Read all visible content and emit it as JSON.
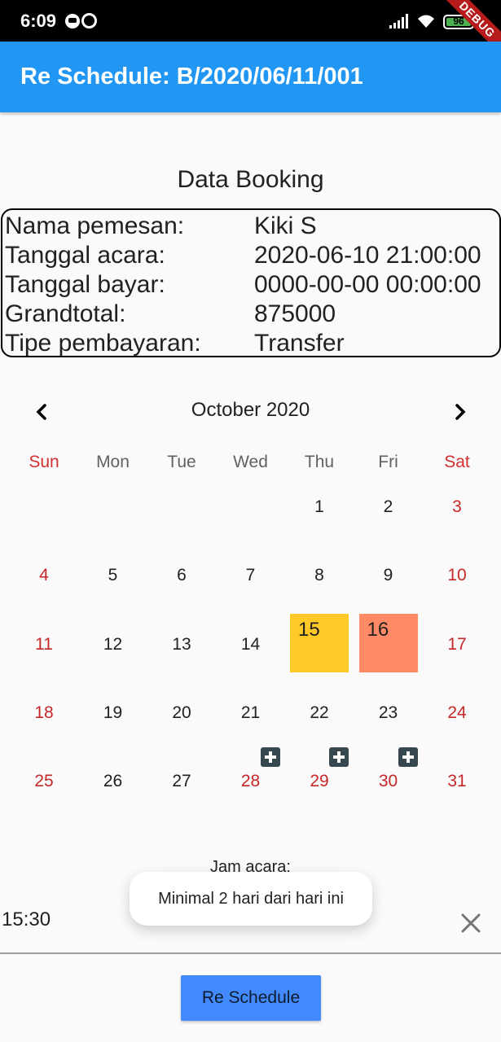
{
  "status_bar": {
    "time": "6:09",
    "battery": "96",
    "debug_label": "DEBUG",
    "icons": [
      "line-app-icon",
      "navigation-icon",
      "signal-icon",
      "wifi-icon",
      "battery-icon"
    ]
  },
  "app_bar": {
    "title": "Re Schedule: B/2020/06/11/001"
  },
  "booking": {
    "section_title": "Data Booking",
    "rows": [
      {
        "label": "Nama pemesan:",
        "value": "Kiki S"
      },
      {
        "label": "Tanggal acara:",
        "value": "2020-06-10 21:00:00"
      },
      {
        "label": "Tanggal bayar:",
        "value": "0000-00-00 00:00:00"
      },
      {
        "label": "Grandtotal:",
        "value": "875000"
      },
      {
        "label": "Tipe pembayaran:",
        "value": "Transfer"
      }
    ]
  },
  "calendar": {
    "month": "October 2020",
    "weekdays": [
      "Sun",
      "Mon",
      "Tue",
      "Wed",
      "Thu",
      "Fri",
      "Sat"
    ],
    "weeks": [
      [
        "",
        "",
        "",
        "",
        "1",
        "2",
        "3"
      ],
      [
        "4",
        "5",
        "6",
        "7",
        "8",
        "9",
        "10"
      ],
      [
        "11",
        "12",
        "13",
        "14",
        "15",
        "16",
        "17"
      ],
      [
        "18",
        "19",
        "20",
        "21",
        "22",
        "23",
        "24"
      ],
      [
        "25",
        "26",
        "27",
        "28",
        "29",
        "30",
        "31"
      ]
    ],
    "highlighted": [
      {
        "day": "15",
        "color": "#ffca28"
      },
      {
        "day": "16",
        "color": "#ff8a65"
      }
    ],
    "red_days": [
      "28",
      "29",
      "30"
    ],
    "add_markers": [
      "28",
      "29",
      "30"
    ],
    "colors": {
      "weekend": "#c62828",
      "weekday": "#212121"
    }
  },
  "time_section": {
    "label": "Jam acara:",
    "value": "15:30"
  },
  "toast": {
    "message": "Minimal 2 hari dari hari ini"
  },
  "actions": {
    "reschedule_label": "Re Schedule"
  },
  "colors": {
    "app_bar": "#2196f3",
    "button": "#448aff"
  }
}
